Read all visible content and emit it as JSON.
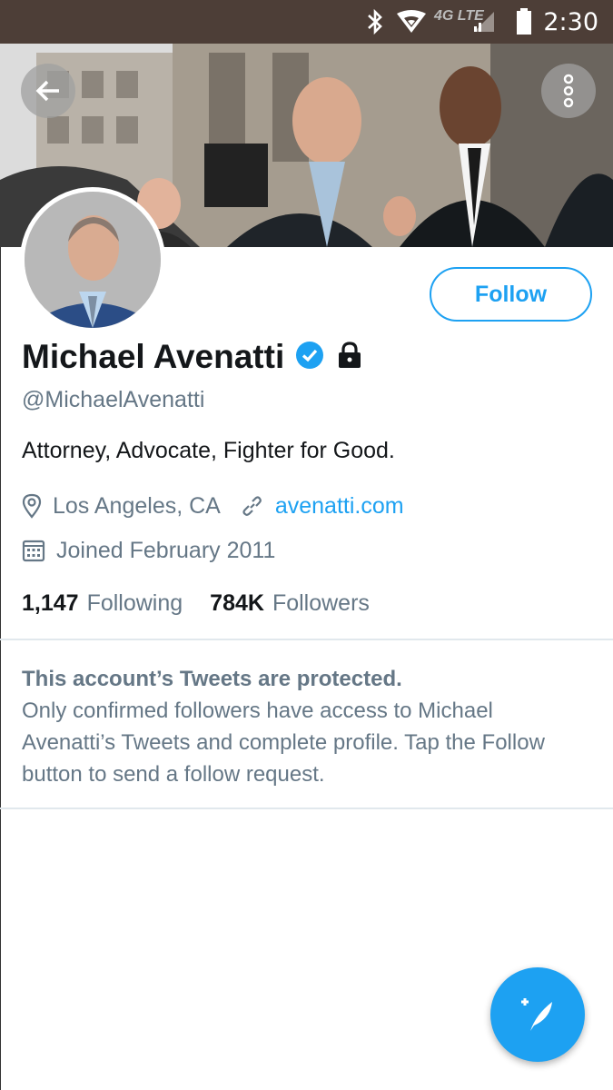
{
  "status_bar": {
    "time": "2:30",
    "network": "4G LTE",
    "icons": [
      "bluetooth-icon",
      "wifi-icon",
      "signal-icon",
      "battery-icon"
    ]
  },
  "header": {
    "back_icon": "back-arrow-icon",
    "overflow_icon": "more-vertical-icon"
  },
  "profile": {
    "display_name": "Michael Avenatti",
    "handle": "@MichaelAvenatti",
    "bio": "Attorney, Advocate, Fighter for Good.",
    "location": "Los Angeles, CA",
    "website": "avenatti.com",
    "joined": "Joined February 2011",
    "following_count": "1,147",
    "following_label": "Following",
    "followers_count": "784K",
    "followers_label": "Followers",
    "follow_button": "Follow"
  },
  "protected_notice": {
    "title": "This account’s Tweets are protected.",
    "body": "Only confirmed followers have access to Michael Avenatti’s Tweets and complete profile. Tap the Follow button to send a follow request."
  },
  "colors": {
    "accent": "#1da1f2",
    "secondary_text": "#657786",
    "status_bar": "#4d3e37"
  }
}
